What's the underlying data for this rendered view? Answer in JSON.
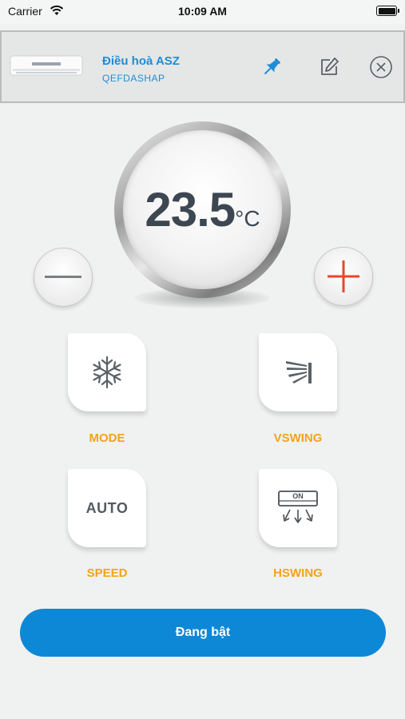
{
  "status_bar": {
    "carrier": "Carrier",
    "time": "10:09 AM"
  },
  "device": {
    "name": "Điều hoà ASZ",
    "code": "QEFDASHAP"
  },
  "header_icons": [
    "pin-icon",
    "edit-icon",
    "close-circle-icon"
  ],
  "temperature": {
    "value": "23.5",
    "unit": "°C"
  },
  "controls": {
    "mode": {
      "label": "MODE",
      "icon": "snowflake-icon"
    },
    "vswing": {
      "label": "VSWING",
      "icon": "vertical-swing-icon"
    },
    "speed": {
      "label": "SPEED",
      "value": "AUTO"
    },
    "hswing": {
      "label": "HSWING",
      "icon": "horizontal-swing-icon",
      "icon_text": "ON"
    }
  },
  "power": {
    "label": "Đang bật"
  },
  "colors": {
    "accent": "#0d88d6",
    "label": "#f4a317",
    "plus": "#e8472a",
    "title": "#1f8dd6"
  }
}
